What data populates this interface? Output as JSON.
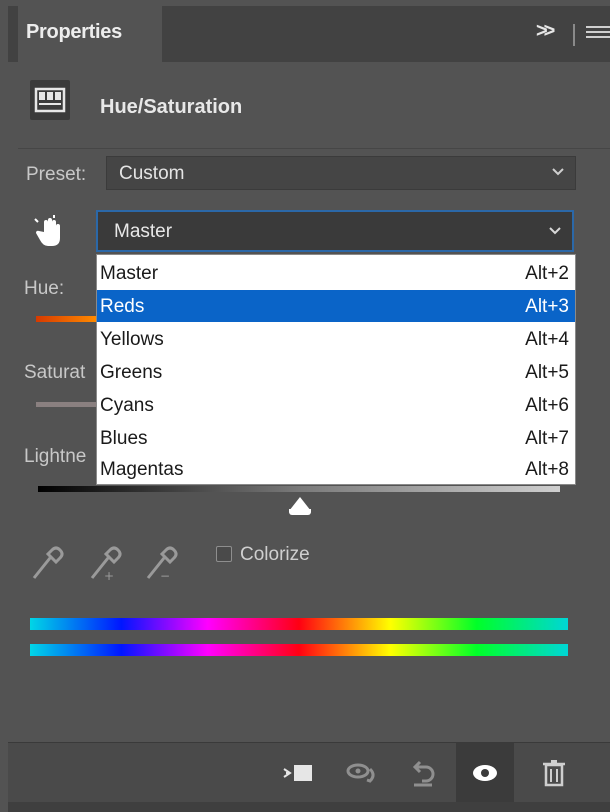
{
  "panel": {
    "tab_title": "Properties",
    "expand_label": ">>",
    "menu_icon": "hamburger-menu-icon"
  },
  "adjustment": {
    "title": "Hue/Saturation",
    "icon": "hue-saturation-layer-icon"
  },
  "preset": {
    "label": "Preset:",
    "value": "Custom"
  },
  "channel": {
    "value": "Master",
    "options": [
      {
        "name": "Master",
        "shortcut": "Alt+2"
      },
      {
        "name": "Reds",
        "shortcut": "Alt+3"
      },
      {
        "name": "Yellows",
        "shortcut": "Alt+4"
      },
      {
        "name": "Greens",
        "shortcut": "Alt+5"
      },
      {
        "name": "Cyans",
        "shortcut": "Alt+6"
      },
      {
        "name": "Blues",
        "shortcut": "Alt+7"
      },
      {
        "name": "Magentas",
        "shortcut": "Alt+8"
      }
    ],
    "highlighted": "Reds"
  },
  "sliders": {
    "hue_label": "Hue:",
    "saturation_label": "Saturat",
    "lightness_label": "Lightne"
  },
  "colorize": {
    "label": "Colorize",
    "checked": false
  },
  "colors": {
    "panel_bg": "#535353",
    "tab_bar": "#424242",
    "selection": "#0a64c8",
    "dropdown_focus": "#2b68a8"
  },
  "footer": {
    "icons": [
      "clip-to-layer-icon",
      "view-previous-state-icon",
      "reset-icon",
      "visibility-eye-icon",
      "delete-trash-icon"
    ]
  }
}
